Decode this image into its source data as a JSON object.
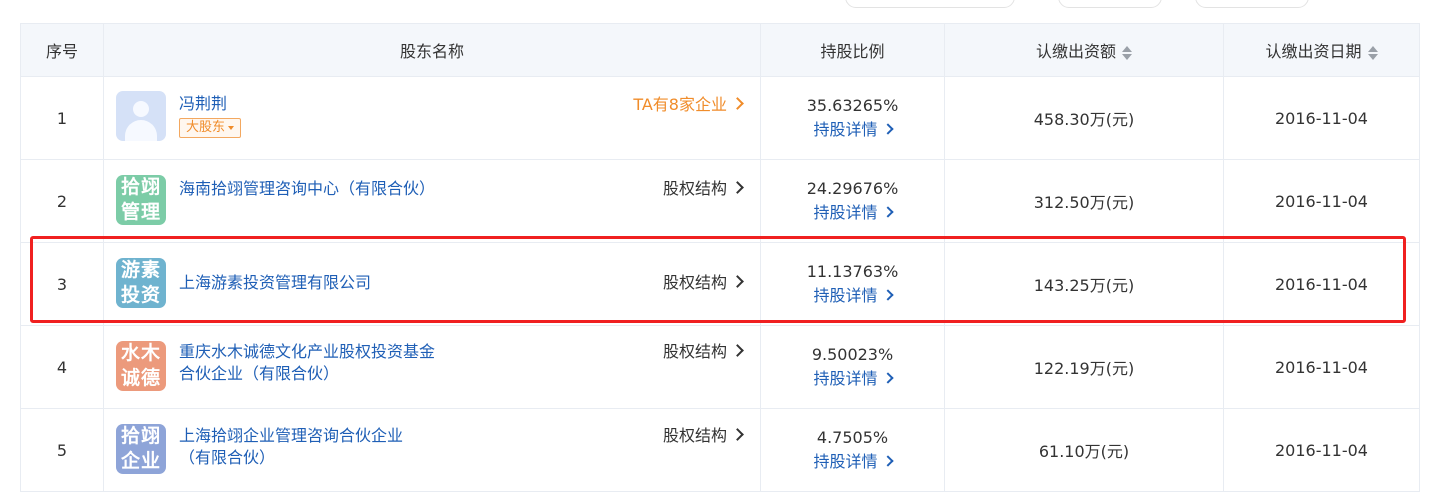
{
  "table": {
    "headers": {
      "index": "序号",
      "name": "股东名称",
      "ratio": "持股比例",
      "amount": "认缴出资额",
      "date": "认缴出资日期"
    },
    "rows": [
      {
        "index": "1",
        "logo_lines": [],
        "logo_color": "#d5e1f7",
        "name": "冯荆荆",
        "tag": "大股东",
        "right_link": "TA有8家企业",
        "ratio": "35.63265%",
        "detail": "持股详情",
        "amount": "458.30万(元)",
        "date": "2016-11-04"
      },
      {
        "index": "2",
        "logo_lines": [
          "拾翊",
          "管理"
        ],
        "logo_color": "#7ccca7",
        "name": "海南拾翊管理咨询中心（有限合伙）",
        "right_link": "股权结构",
        "ratio": "24.29676%",
        "detail": "持股详情",
        "amount": "312.50万(元)",
        "date": "2016-11-04"
      },
      {
        "index": "3",
        "logo_lines": [
          "游素",
          "投资"
        ],
        "logo_color": "#6fb3cf",
        "name": "上海游素投资管理有限公司",
        "right_link": "股权结构",
        "ratio": "11.13763%",
        "detail": "持股详情",
        "amount": "143.25万(元)",
        "date": "2016-11-04"
      },
      {
        "index": "4",
        "logo_lines": [
          "水木",
          "诚德"
        ],
        "logo_color": "#ec9a7c",
        "name": "重庆水木诚德文化产业股权投资基金合伙企业（有限合伙）",
        "right_link": "股权结构",
        "ratio": "9.50023%",
        "detail": "持股详情",
        "amount": "122.19万(元)",
        "date": "2016-11-04"
      },
      {
        "index": "5",
        "logo_lines": [
          "拾翊",
          "企业"
        ],
        "logo_color": "#8ea4d8",
        "name": "上海拾翊企业管理咨询合伙企业（有限合伙）",
        "right_link": "股权结构",
        "ratio": "4.7505%",
        "detail": "持股详情",
        "amount": "61.10万(元)",
        "date": "2016-11-04"
      }
    ]
  },
  "colors": {
    "link_blue": "#1f5fb6",
    "orange": "#f08c2a",
    "highlight_red": "#f02020",
    "header_bg": "#f4f7fb"
  }
}
